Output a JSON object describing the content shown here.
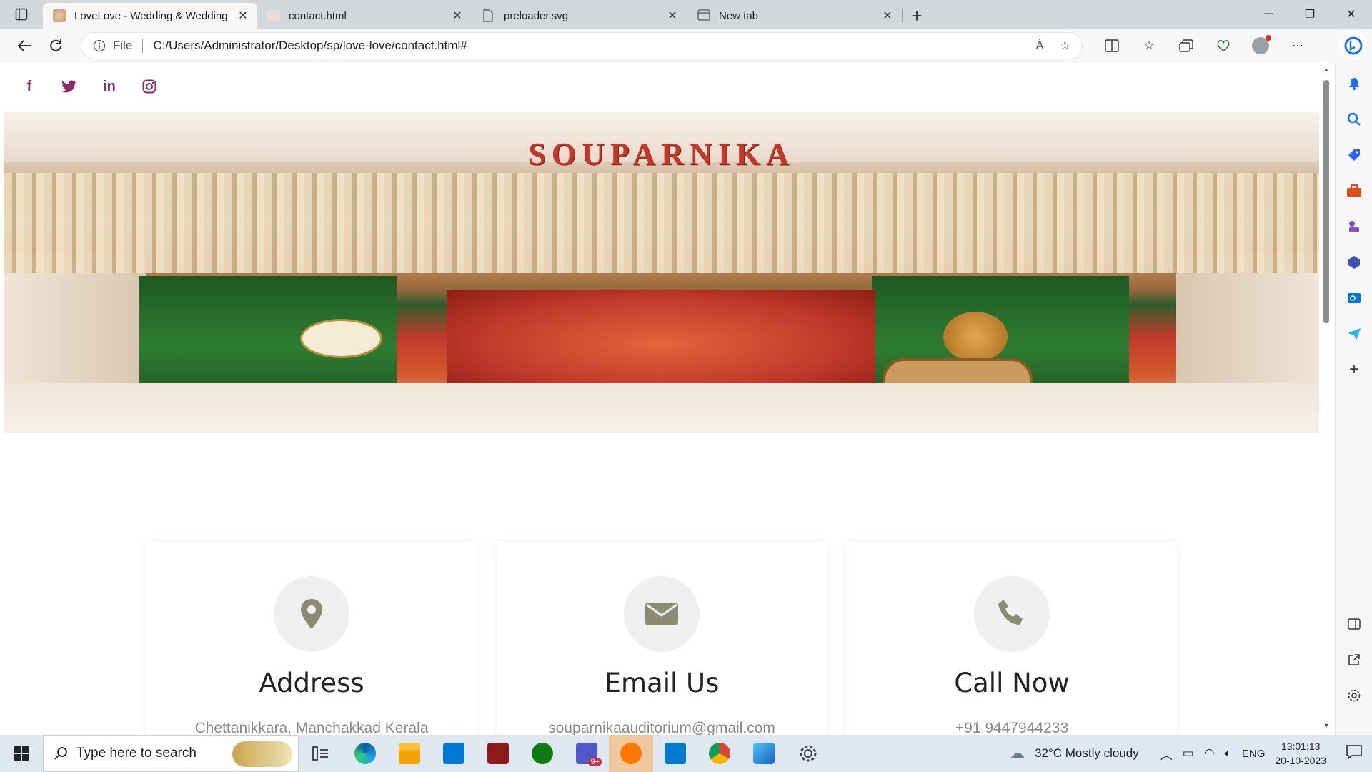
{
  "browser": {
    "tabs": [
      {
        "title": "LoveLove - Wedding & Wedding",
        "active": true
      },
      {
        "title": "contact.html",
        "active": false
      },
      {
        "title": "preloader.svg",
        "active": false
      },
      {
        "title": "New tab",
        "active": false
      }
    ],
    "address": {
      "scheme_label": "File",
      "url": "C:/Users/Administrator/Desktop/sp/love-love/contact.html#"
    }
  },
  "page": {
    "social_icons": [
      "facebook-icon",
      "twitter-icon",
      "linkedin-icon",
      "instagram-icon"
    ],
    "hero_sign": "SOUPARNIKA",
    "cards": [
      {
        "title": "Address",
        "text": "Chettanikkara, Manchakkad Kerala",
        "icon": "map-pin-icon"
      },
      {
        "title": "Email Us",
        "text": "souparnikaauditorium@gmail.com",
        "icon": "envelope-icon"
      },
      {
        "title": "Call Now",
        "text": "+91 9447944233",
        "icon": "phone-icon"
      }
    ],
    "accent_color": "#8a2a6b"
  },
  "taskbar": {
    "search_placeholder": "Type here to search",
    "weather": "32°C  Mostly cloudy",
    "lang": "ENG",
    "time": "13:01:13",
    "date": "20-10-2023",
    "teams_badge": "9+"
  }
}
